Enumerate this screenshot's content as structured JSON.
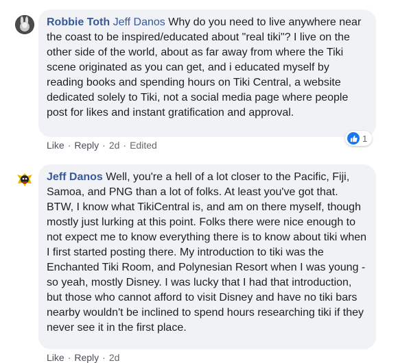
{
  "comments": [
    {
      "author": "Robbie Toth",
      "mention": "Jeff Danos",
      "text": " Why do you need to live anywhere near the coast to be inspired/educated about \"real tiki\"? I live on the other side of the world, about as far away from where the Tiki scene originated as you can get, and i educated myself by reading books and spending hours on Tiki Central, a website dedicated solely to Tiki, not a social media page where people post for likes and instant gratification and approval.",
      "actions": {
        "like": "Like",
        "reply": "Reply",
        "time": "2d",
        "edited": "Edited"
      },
      "reaction_count": "1",
      "reaction_icon": "like-icon"
    },
    {
      "author": "Jeff Danos",
      "text": " Well, you're a hell of a lot closer to the Pacific, Fiji, Samoa, and PNG than a lot of folks. At least you've got that. BTW, I know what TikiCentral is, and am on there myself, though mostly just lurking at this point. Folks there were nice enough to not expect me to know everything there is to know about tiki when I first started posting there. My introduction to tiki was the Enchanted Tiki Room, and Polynesian Resort when I was young - so yeah, mostly Disney. I was lucky that I had that introduction, but those who cannot afford to visit Disney and have no tiki bars nearby wouldn't be inclined to spend hours researching tiki if they never see it in the first place.",
      "actions": {
        "like": "Like",
        "reply": "Reply",
        "time": "2d"
      }
    }
  ],
  "colors": {
    "link": "#385898",
    "bubble": "#f0f2f5",
    "meta": "#65676b",
    "like": "#1877f2"
  }
}
